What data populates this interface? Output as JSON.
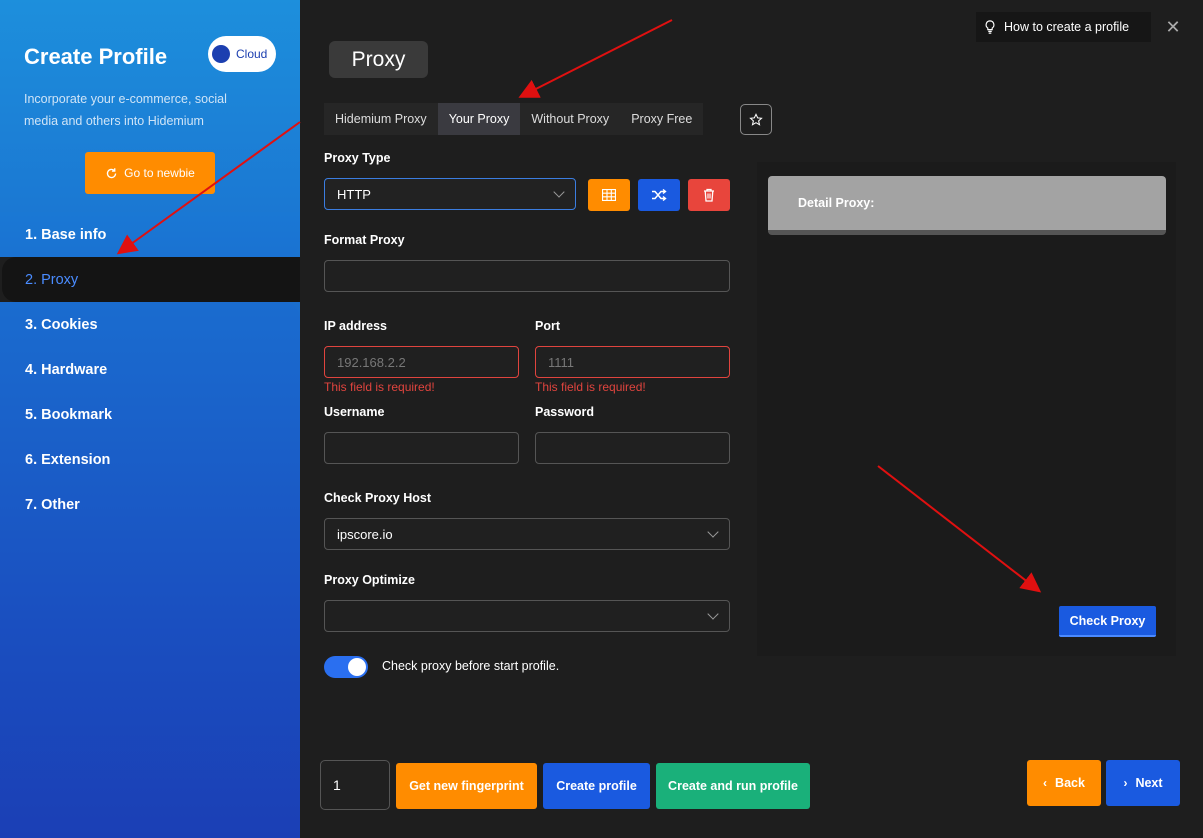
{
  "sidebar": {
    "title": "Create Profile",
    "cloud_label": "Cloud",
    "description": "Incorporate your e-commerce, social media and others into Hidemium",
    "newbie_label": "Go to newbie",
    "nav": [
      {
        "label": "1. Base info"
      },
      {
        "label": "2. Proxy"
      },
      {
        "label": "3. Cookies"
      },
      {
        "label": "4. Hardware"
      },
      {
        "label": "5. Bookmark"
      },
      {
        "label": "6. Extension"
      },
      {
        "label": "7. Other"
      }
    ]
  },
  "header": {
    "title": "Proxy",
    "howto_label": "How to create a profile"
  },
  "tabs": [
    {
      "label": "Hidemium Proxy"
    },
    {
      "label": "Your Proxy"
    },
    {
      "label": "Without Proxy"
    },
    {
      "label": "Proxy Free"
    }
  ],
  "form": {
    "proxy_type_label": "Proxy Type",
    "proxy_type_value": "HTTP",
    "format_proxy_label": "Format Proxy",
    "format_proxy_value": "",
    "ip_label": "IP address",
    "ip_placeholder": "192.168.2.2",
    "ip_error": "This field is required!",
    "port_label": "Port",
    "port_placeholder": "1111",
    "port_error": "This field is required!",
    "username_label": "Username",
    "password_label": "Password",
    "check_host_label": "Check Proxy Host",
    "check_host_value": "ipscore.io",
    "optimize_label": "Proxy Optimize",
    "optimize_value": "",
    "toggle_label": "Check proxy before start profile."
  },
  "detail": {
    "label": "Detail Proxy:",
    "check_button": "Check Proxy"
  },
  "footer": {
    "quantity": "1",
    "fingerprint_label": "Get new fingerprint",
    "create_label": "Create profile",
    "create_run_label": "Create and run profile",
    "back_label": "Back",
    "next_label": "Next"
  },
  "colors": {
    "orange": "#ff8c00",
    "blue": "#1a5ae0",
    "red": "#e8453c",
    "green": "#1ab07a"
  }
}
